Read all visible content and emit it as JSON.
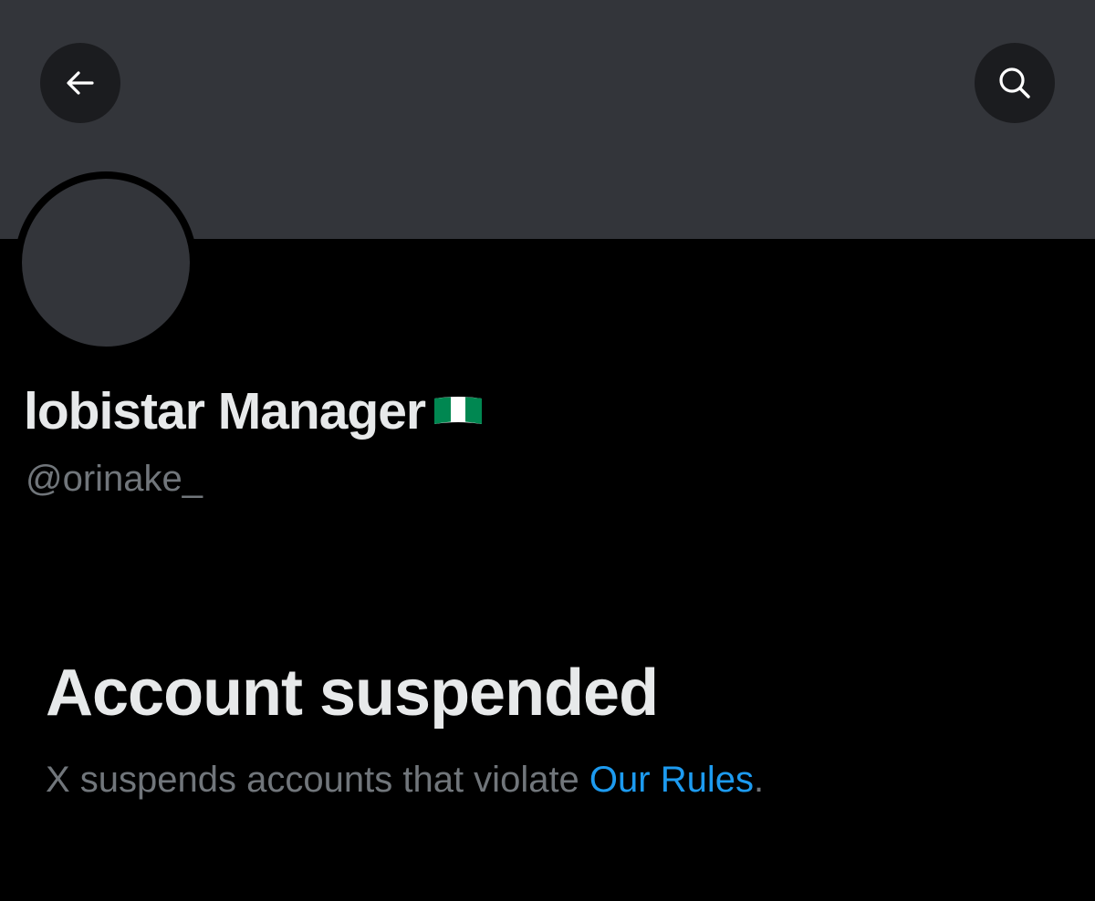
{
  "header": {
    "back_icon": "arrow-left-icon",
    "search_icon": "search-icon"
  },
  "profile": {
    "display_name": "lobistar Manager",
    "flag_icon": "nigeria-flag-icon",
    "handle": "@orinake_"
  },
  "suspension": {
    "title": "Account suspended",
    "description_prefix": "X suspends accounts that violate ",
    "rules_link": "Our Rules",
    "description_suffix": "."
  },
  "colors": {
    "banner": "#33353a",
    "background": "#000000",
    "primary_text": "#e7e9ea",
    "secondary_text": "#71767b",
    "link": "#1d9bf0",
    "flag_green": "#008751",
    "flag_white": "#ffffff"
  }
}
